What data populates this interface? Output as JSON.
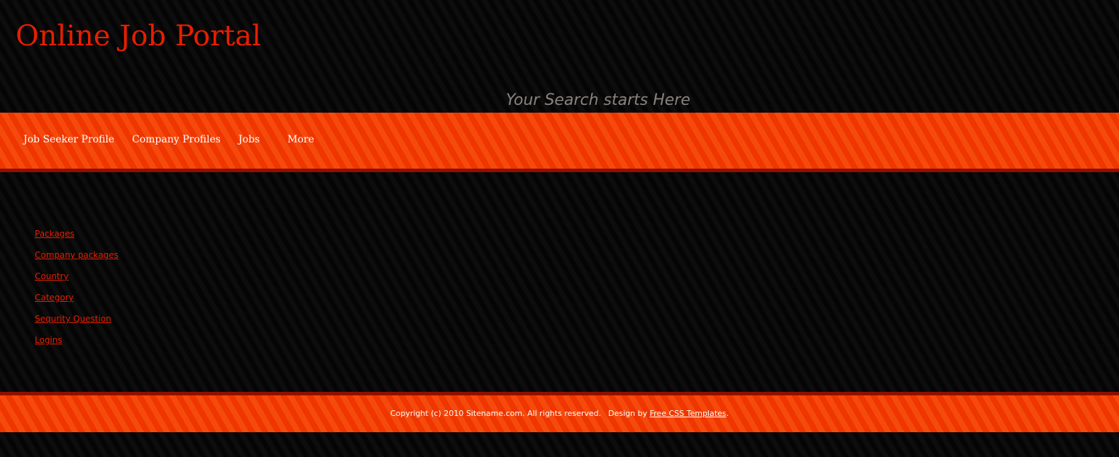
{
  "header": {
    "title": "Online Job Portal",
    "tagline": "Your Search starts Here"
  },
  "nav": {
    "items": [
      {
        "label": "Job Seeker Profile"
      },
      {
        "label": "Company Profiles"
      },
      {
        "label": "Jobs"
      },
      {
        "label": "More"
      }
    ]
  },
  "sidebar": {
    "links": [
      {
        "label": "Packages"
      },
      {
        "label": "Company packages"
      },
      {
        "label": "Country"
      },
      {
        "label": "Category"
      },
      {
        "label": "Sequrity Question"
      },
      {
        "label": "Logins"
      }
    ]
  },
  "footer": {
    "copyright": "Copyright (c) 2010 Sitename.com. All rights reserved.",
    "design_by_prefix": "Design by",
    "design_link": "Free CSS Templates",
    "suffix": "."
  },
  "colors": {
    "accent": "#e61e00",
    "bar": "#f03a00",
    "bar_rule": "#8e1000",
    "background": "#0b0b0b",
    "tagline": "#8a827c"
  }
}
